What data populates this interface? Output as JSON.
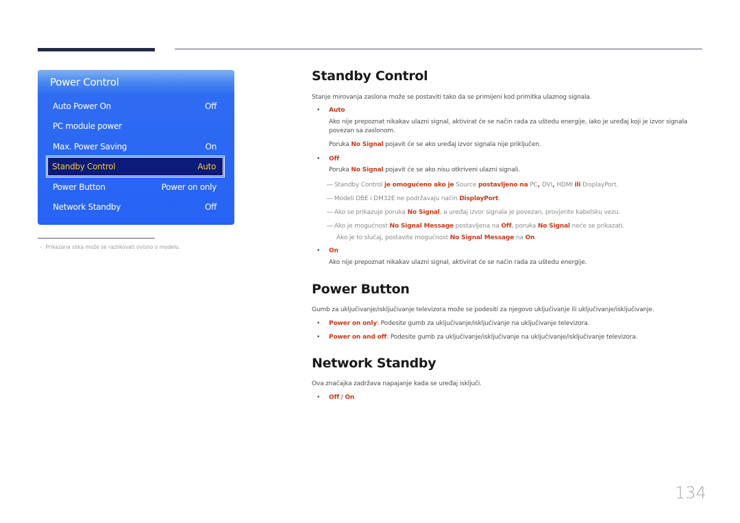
{
  "osd": {
    "title": "Power Control",
    "items": [
      {
        "label": "Auto Power On",
        "value": "Off"
      },
      {
        "label": "PC module power",
        "value": ""
      },
      {
        "label": "Max. Power Saving",
        "value": "On"
      },
      {
        "label": "Standby Control",
        "value": "Auto",
        "selected": true
      },
      {
        "label": "Power Button",
        "value": "Power on only"
      },
      {
        "label": "Network Standby",
        "value": "Off"
      }
    ]
  },
  "footnote": "Prikazana slika može se razlikovati ovisno o modelu.",
  "footnote_dash": "–",
  "standby": {
    "title": "Standby Control",
    "intro": "Stanje mirovanja zaslona može se postaviti tako da se primijeni kod primitka ulaznog signala.",
    "auto": {
      "label": "Auto",
      "desc": "Ako nije prepoznat nikakav ulazni signal, aktivirat će se način rada za uštedu energije, iako je uređaj koji je izvor signala povezan sa zaslonom.",
      "msg_pre": "Poruka ",
      "msg_red": "No Signal",
      "msg_post": " pojavit će se ako uređaj izvor signala nije priključen."
    },
    "off": {
      "label": "Off",
      "msg_pre": "Poruka ",
      "msg_red": "No Signal",
      "msg_post": " pojavit će se ako nisu otkriveni ulazni signali."
    },
    "notes": {
      "n1": [
        "Standby Control ",
        "je omogućeno ako je",
        " Source ",
        "postavljeno na",
        " PC",
        ", ",
        "DVI",
        ", ",
        "HDMI ",
        "ili",
        " DisplayPort."
      ],
      "n2": [
        "Modeli DBE i DM32E ne podržavaju način ",
        "DisplayPort",
        "."
      ],
      "n3": [
        "Ako se prikazuje poruka ",
        "No Signal",
        ", a uređaj izvor signala je povezan, provjerite kabelsku vezu."
      ],
      "n4": [
        "Ako je mogućnost ",
        "No Signal Message",
        " postavljena na ",
        "Off",
        ", poruka ",
        "No Signal",
        " neće se prikazati."
      ],
      "n5": [
        "Ako je to slučaj, postavite mogućnost ",
        "No Signal Message",
        " na ",
        "On",
        "."
      ]
    },
    "on": {
      "label": "On",
      "desc": "Ako nije prepoznat nikakav ulazni signal, aktivirat će se način rada za uštedu energije."
    }
  },
  "power_button": {
    "title": "Power Button",
    "intro": "Gumb za uključivanje/isključivanje televizora može se podesiti za njegovo uključivanje ili uključivanje/isključivanje.",
    "options": [
      {
        "label": "Power on only",
        "desc": ": Podesite gumb za uključivanje/isključivanje na uključivanje televizora."
      },
      {
        "label": "Power on and off",
        "desc": ": Podesite gumb za uključivanje/isključivanje na uključivanje/isključivanje televizora."
      }
    ]
  },
  "network_standby": {
    "title": "Network Standby",
    "intro": "Ova značajka zadržava napajanje kada se uređaj isključi.",
    "opt_off": "Off",
    "opt_sep": " / ",
    "opt_on": "On"
  },
  "bullet": "•",
  "note_dash": "―",
  "page_number": "134",
  "colors": {
    "accent_red": "#c8381a",
    "osd_blue": "#2763f5",
    "osd_selected_bg": "#0c1a7a",
    "osd_selected_text": "#f5c53a"
  }
}
